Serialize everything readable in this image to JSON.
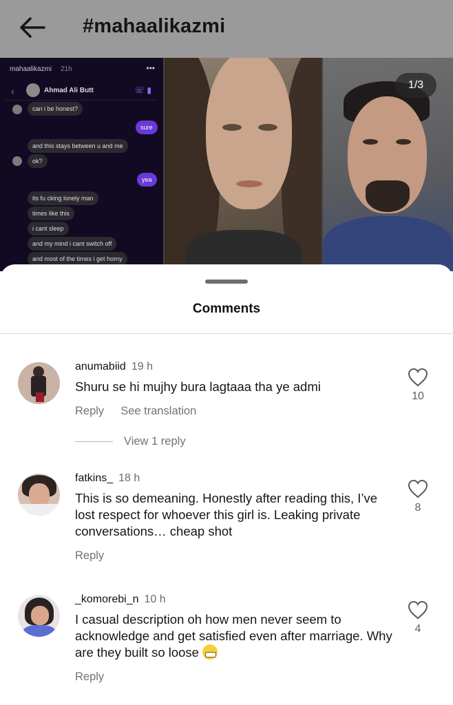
{
  "header": {
    "title": "#mahaalikazmi"
  },
  "media": {
    "counter": "1/3",
    "chat_screenshot": {
      "author": "mahaalikazmi",
      "age": "21h",
      "contact_name": "Ahmad Ali Butt",
      "messages": [
        {
          "from": "them",
          "text": "can i be honest?"
        },
        {
          "from": "me",
          "text": "sure"
        },
        {
          "from": "them",
          "text": "and this stays between u and me"
        },
        {
          "from": "them",
          "text": "ok?"
        },
        {
          "from": "me",
          "text": "yea"
        },
        {
          "from": "them",
          "text": "its fu cking lonely man"
        },
        {
          "from": "them",
          "text": "times like this"
        },
        {
          "from": "them",
          "text": "i cant sleep"
        },
        {
          "from": "them",
          "text": "and my mind i cant switch off"
        },
        {
          "from": "them",
          "text": "and most of the times i get horny"
        }
      ]
    }
  },
  "comments_sheet": {
    "title": "Comments",
    "comments": [
      {
        "username": "anumabiid",
        "time": "19 h",
        "text": "Shuru se hi mujhy bura lagtaaa tha ye admi",
        "reply_label": "Reply",
        "translation_label": "See translation",
        "likes": "10",
        "view_replies": "View 1 reply"
      },
      {
        "username": "fatkins_",
        "time": "18 h",
        "text": "This is so demeaning. Honestly after reading this, I’ve lost respect for whoever this girl is. Leaking private conversations… cheap shot",
        "reply_label": "Reply",
        "likes": "8"
      },
      {
        "username": "_komorebi_n",
        "time": "10 h",
        "text": "I casual description oh how men never seem to acknowledge and get satisfied even after marriage. Why are they built so loose",
        "emoji": "grimacing-face",
        "reply_label": "Reply",
        "likes": "4"
      }
    ]
  },
  "colors": {
    "overlay_dim": "#9a9a9a",
    "chat_bubble_sent": "#6a39d8",
    "chat_background": "#120a22",
    "secondary_text": "#737373"
  }
}
